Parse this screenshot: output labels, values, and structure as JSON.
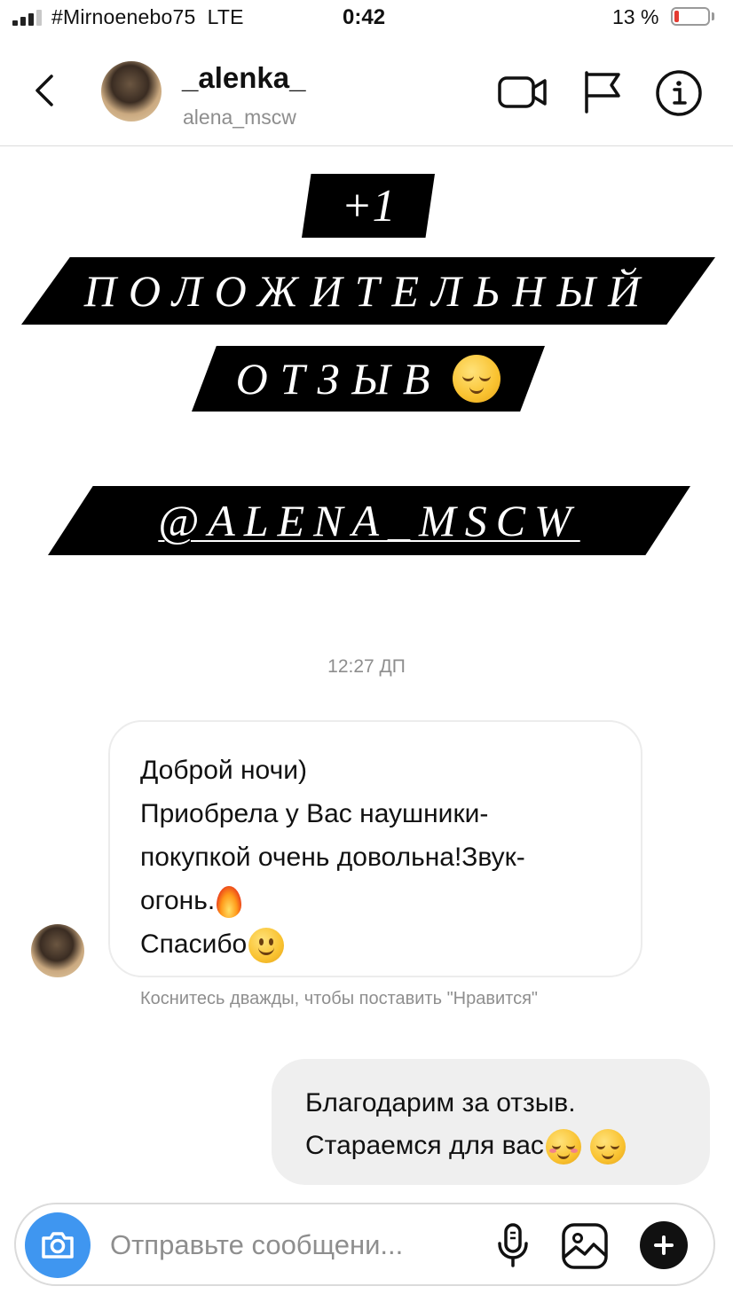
{
  "status_bar": {
    "carrier": "#Mirnoenebo75",
    "network": "LTE",
    "time": "0:42",
    "battery_percent": "13 %",
    "battery_level": 0.13,
    "signal_bars_active": 3,
    "signal_bars_total": 4
  },
  "header": {
    "display_name": "_alenka_",
    "username": "alena_mscw",
    "icons": [
      "chevron-left-icon",
      "video-camera-icon",
      "flag-icon",
      "info-icon"
    ]
  },
  "story": {
    "line1": "+1",
    "line2": "ПОЛОЖИТЕЛЬНЫЙ",
    "line3": "ОТЗЫВ",
    "line3_emoji": "relieved-face-emoji",
    "line4": "@ALENA_MSCW"
  },
  "chat": {
    "timestamp": "12:27 ДП",
    "incoming": {
      "lines": [
        "Доброй ночи)",
        "Приобрела у Вас наушники-",
        "покупкой очень довольна!Звук-",
        "огонь.",
        "Спасибо"
      ],
      "emojis": [
        "fire-emoji",
        "slightly-smiling-face-emoji"
      ]
    },
    "hint": "Коснитесь дважды, чтобы поставить \"Нравится\"",
    "outgoing": {
      "lines": [
        "Благодарим за отзыв.",
        "Стараемся для вас"
      ],
      "emojis": [
        "smiling-face-emoji",
        "relieved-face-emoji"
      ]
    }
  },
  "composer": {
    "placeholder": "Отправьте сообщени...",
    "icons": [
      "camera-icon",
      "microphone-icon",
      "gallery-icon",
      "plus-icon"
    ]
  },
  "colors": {
    "accent_blue": "#3f96f0",
    "battery_low": "#e43b31",
    "secondary_text": "#8e8e8e",
    "outgoing_bubble": "#efefef",
    "banner": "#000000"
  }
}
